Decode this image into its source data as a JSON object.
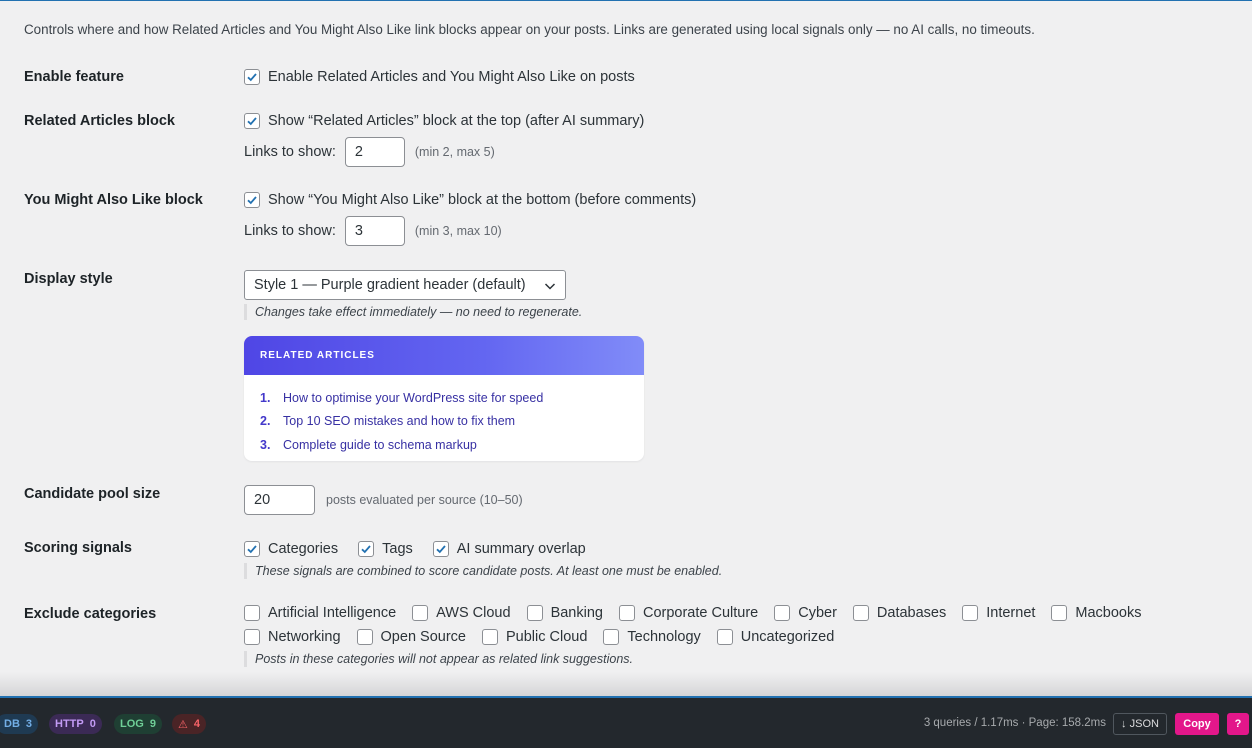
{
  "intro": "Controls where and how Related Articles and You Might Also Like link blocks appear on your posts. Links are generated using local signals only — no AI calls, no timeouts.",
  "enable": {
    "label": "Enable feature",
    "checkbox_label": "Enable Related Articles and You Might Also Like on posts",
    "checked": true
  },
  "related": {
    "label": "Related Articles block",
    "checkbox_label": "Show “Related Articles” block at the top (after AI summary)",
    "checked": true,
    "links_label": "Links to show:",
    "links_value": "2",
    "links_hint": "(min 2, max 5)"
  },
  "ymal": {
    "label": "You Might Also Like block",
    "checkbox_label": "Show “You Might Also Like” block at the bottom (before comments)",
    "checked": true,
    "links_label": "Links to show:",
    "links_value": "3",
    "links_hint": "(min 3, max 10)"
  },
  "display": {
    "label": "Display style",
    "selected": "Style 1 — Purple gradient header (default)",
    "note": "Changes take effect immediately — no need to regenerate.",
    "preview": {
      "header": "RELATED ARTICLES",
      "items": [
        {
          "num": "1.",
          "title": "How to optimise your WordPress site for speed"
        },
        {
          "num": "2.",
          "title": "Top 10 SEO mistakes and how to fix them"
        },
        {
          "num": "3.",
          "title": "Complete guide to schema markup"
        }
      ]
    }
  },
  "pool": {
    "label": "Candidate pool size",
    "value": "20",
    "hint": "posts evaluated per source (10–50)"
  },
  "signals": {
    "label": "Scoring signals",
    "options": [
      {
        "label": "Categories",
        "checked": true
      },
      {
        "label": "Tags",
        "checked": true
      },
      {
        "label": "AI summary overlap",
        "checked": true
      }
    ],
    "note": "These signals are combined to score candidate posts. At least one must be enabled."
  },
  "exclude": {
    "label": "Exclude categories",
    "categories": [
      "Artificial Intelligence",
      "AWS Cloud",
      "Banking",
      "Corporate Culture",
      "Cyber",
      "Databases",
      "Internet",
      "Macbooks",
      "Networking",
      "Open Source",
      "Public Cloud",
      "Technology",
      "Uncategorized"
    ],
    "note": "Posts in these categories will not appear as related link suggestions."
  },
  "toolbar": {
    "db_label": "DB",
    "db_count": "3",
    "http_label": "HTTP",
    "http_count": "0",
    "log_label": "LOG",
    "log_count": "9",
    "warn_icon": "⚠",
    "warn_count": "4",
    "stats": "3 queries / 1.17ms · Page: 158.2ms",
    "json_label": "↓ JSON",
    "copy_label": "Copy",
    "help_label": "?"
  },
  "colors": {
    "accent": "#2271b1",
    "check": "#2271b1",
    "preview_gradient_start": "#4f46e5",
    "preview_gradient_end": "#818cf8",
    "copy_button": "#e3178a"
  }
}
